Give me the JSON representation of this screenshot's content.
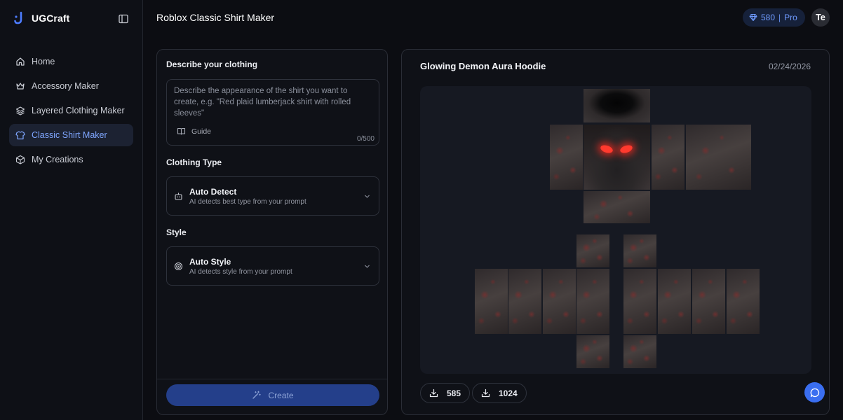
{
  "app": {
    "name": "UGCraft"
  },
  "sidebar": {
    "items": [
      {
        "label": "Home",
        "icon": "home-icon"
      },
      {
        "label": "Accessory Maker",
        "icon": "crown-icon"
      },
      {
        "label": "Layered Clothing Maker",
        "icon": "layers-icon"
      },
      {
        "label": "Classic Shirt Maker",
        "icon": "shirt-icon",
        "active": true
      },
      {
        "label": "My Creations",
        "icon": "box-icon"
      }
    ]
  },
  "header": {
    "title": "Roblox Classic Shirt Maker",
    "credits": "580",
    "credits_separator": "|",
    "plan": "Pro",
    "avatar_initials": "Te"
  },
  "form": {
    "describe_label": "Describe your clothing",
    "describe_placeholder": "Describe the appearance of the shirt you want to create, e.g. \"Red plaid lumberjack shirt with rolled sleeves\"",
    "guide_label": "Guide",
    "char_counter": "0/500",
    "clothing_type_label": "Clothing Type",
    "clothing_type": {
      "title": "Auto Detect",
      "subtitle": "AI detects best type from your prompt"
    },
    "style_label": "Style",
    "style": {
      "title": "Auto Style",
      "subtitle": "AI detects style from your prompt"
    },
    "create_label": "Create"
  },
  "preview": {
    "title": "Glowing Demon Aura Hoodie",
    "date": "02/24/2026",
    "downloads": "585",
    "resolution": "1024"
  },
  "colors": {
    "accent": "#3a6ef0",
    "active_nav_bg": "#1c2232",
    "active_nav_text": "#7fa6ff",
    "create_button": "#243f8a",
    "eye_glow": "#ff3a2e"
  }
}
